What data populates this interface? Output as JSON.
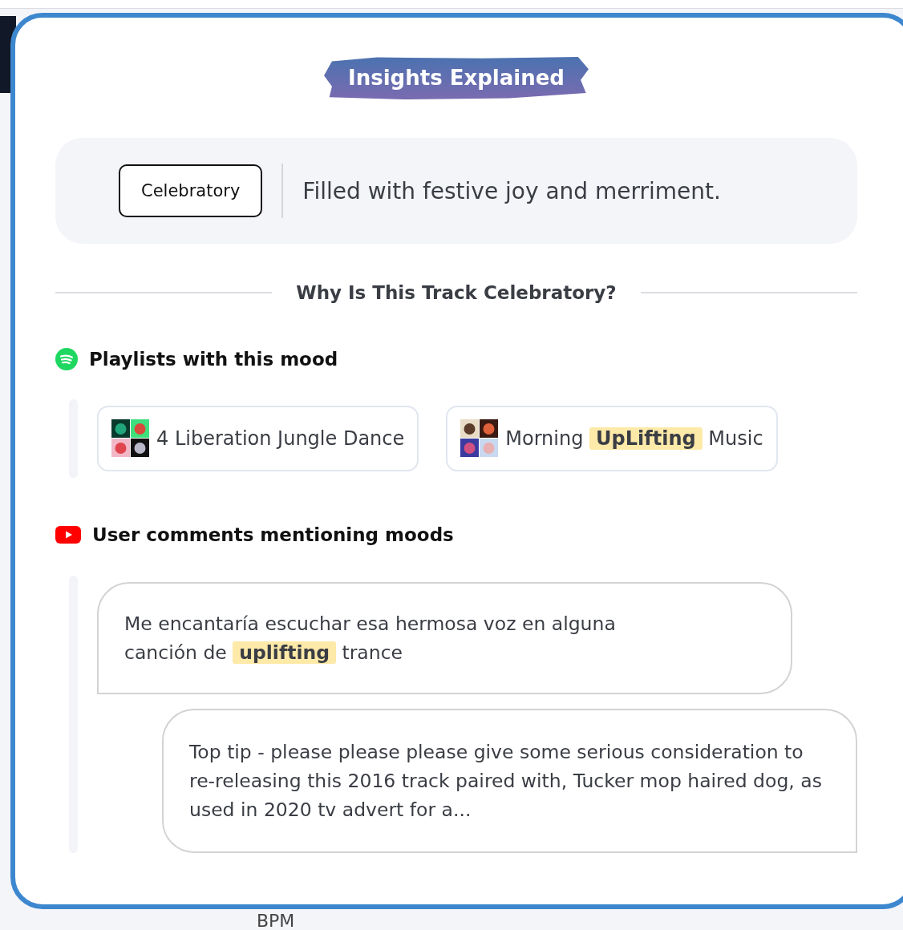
{
  "title": "Insights Explained",
  "mood": {
    "label": "Celebratory",
    "description": "Filled with festive joy and merriment."
  },
  "why_heading": "Why Is This Track Celebratory?",
  "playlists": {
    "heading": "Playlists with this mood",
    "items": [
      {
        "segments": [
          {
            "text": "4 Liberation Jungle Dance",
            "highlighted": false
          }
        ]
      },
      {
        "segments": [
          {
            "text": "Morning ",
            "highlighted": false
          },
          {
            "text": "UpLifting",
            "highlighted": true
          },
          {
            "text": " Music",
            "highlighted": false
          }
        ]
      }
    ]
  },
  "comments": {
    "heading": "User comments mentioning moods",
    "items": [
      {
        "kind": "left",
        "segments": [
          {
            "text": "Me encantaría escuchar esa hermosa voz en alguna canción de ",
            "highlighted": false
          },
          {
            "text": "uplifting",
            "highlighted": true
          },
          {
            "text": " trance",
            "highlighted": false
          }
        ]
      },
      {
        "kind": "right",
        "segments": [
          {
            "text": "Top tip - please please please give some serious consideration to re-releasing this 2016 track paired with, Tucker mop haired dog, as used in 2020 tv advert for a...",
            "highlighted": false
          }
        ]
      }
    ]
  },
  "background_label": "BPM"
}
